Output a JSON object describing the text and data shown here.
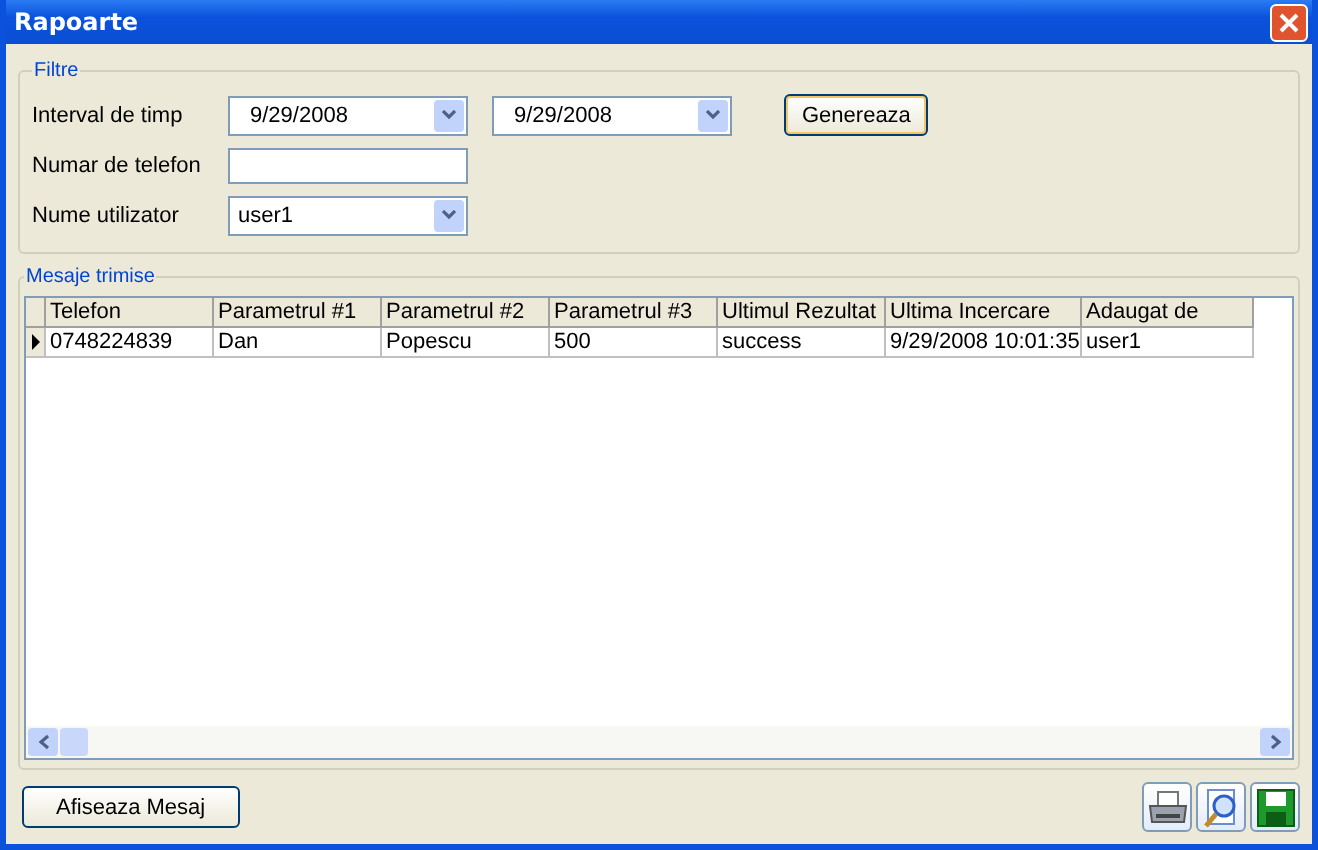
{
  "window": {
    "title": "Rapoarte"
  },
  "filters": {
    "title": "Filtre",
    "interval": {
      "label": "Interval de timp",
      "from": "9/29/2008",
      "to": "9/29/2008"
    },
    "generate_button": "Genereaza",
    "phone": {
      "label": "Numar de telefon"
    },
    "user": {
      "label": "Nume utilizator",
      "value": "user1"
    }
  },
  "messages": {
    "title": "Mesaje trimise",
    "columns": [
      "Telefon",
      "Parametrul #1",
      "Parametrul #2",
      "Parametrul #3",
      "Ultimul Rezultat",
      "Ultima Incercare",
      "Adaugat de"
    ],
    "rows": [
      {
        "current": true,
        "cells": [
          "0748224839",
          "Dan",
          "Popescu",
          "500",
          "success",
          "9/29/2008 10:01:35",
          "user1"
        ]
      }
    ]
  },
  "show_message_button": "Afiseaza Mesaj"
}
